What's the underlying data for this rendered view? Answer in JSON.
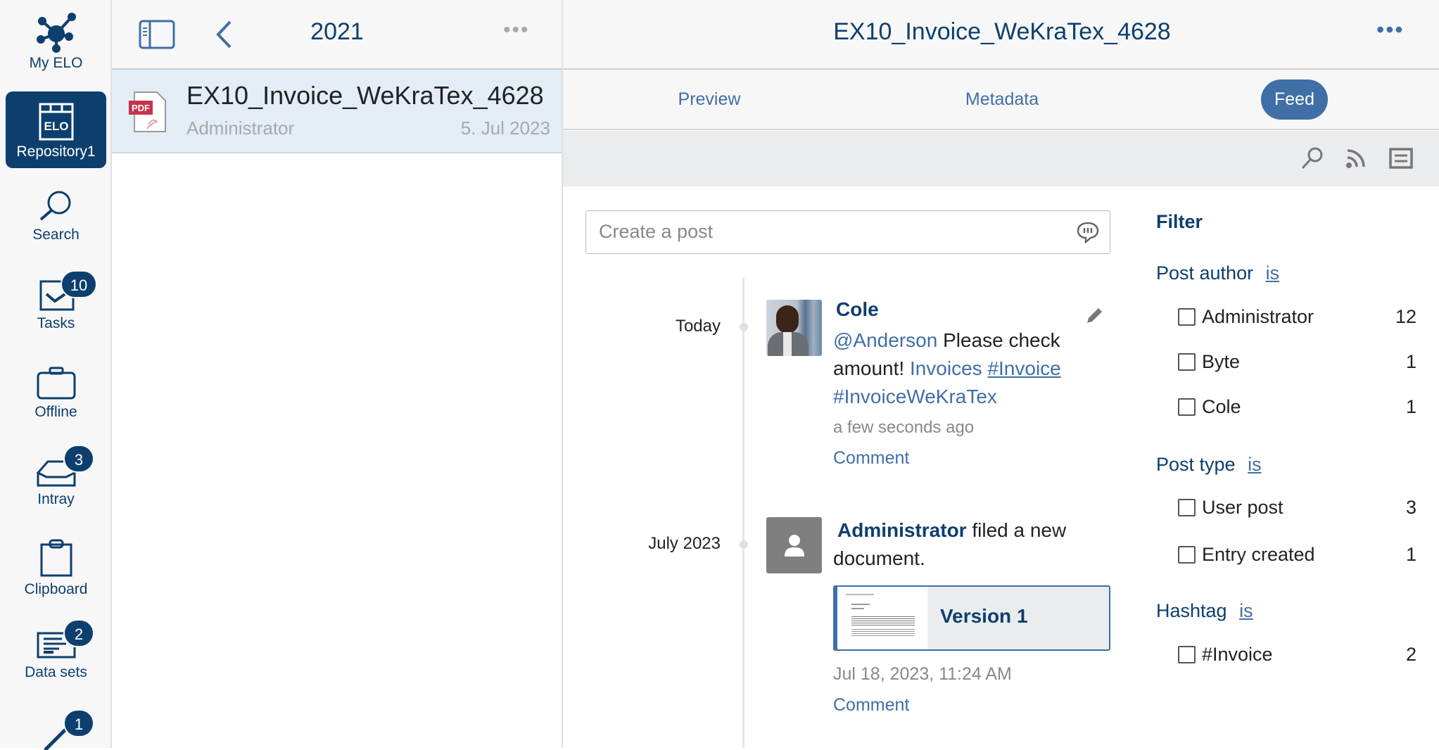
{
  "sidebar": {
    "items": [
      {
        "label": "My ELO",
        "icon": "network-icon"
      },
      {
        "label": "Repository1",
        "icon": "repository-icon",
        "active": true
      },
      {
        "label": "Search",
        "icon": "search-icon"
      },
      {
        "label": "Tasks",
        "icon": "tasks-icon",
        "badge": "10"
      },
      {
        "label": "Offline",
        "icon": "briefcase-icon"
      },
      {
        "label": "Intray",
        "icon": "intray-icon",
        "badge": "3"
      },
      {
        "label": "Clipboard",
        "icon": "clipboard-icon"
      },
      {
        "label": "Data sets",
        "icon": "data-sets-icon",
        "badge": "2"
      },
      {
        "label": "",
        "icon": "pen-icon",
        "badge": "1"
      }
    ]
  },
  "list": {
    "title": "2021",
    "items": [
      {
        "name": "EX10_Invoice_WeKraTex_4628",
        "author": "Administrator",
        "date": "5. Jul 2023",
        "type": "PDF"
      }
    ]
  },
  "viewer": {
    "title": "EX10_Invoice_WeKraTex_4628",
    "tabs": [
      {
        "label": "Preview"
      },
      {
        "label": "Metadata"
      },
      {
        "label": "Feed",
        "active": true
      }
    ]
  },
  "feed": {
    "placeholder": "Create a post",
    "groups": [
      {
        "label": "Today",
        "post": {
          "author": "Cole",
          "mention": "@Anderson",
          "text": " Please check amount! ",
          "link": "Invoices",
          "hashtag1": "#Invoice",
          "hashtag2": "#InvoiceWeKraTex",
          "time": "a few seconds ago",
          "comment": "Comment"
        }
      },
      {
        "label": "July 2023",
        "post": {
          "author": "Administrator",
          "text": " filed a new document.",
          "version": "Version 1",
          "time": "Jul 18, 2023, 11:24 AM",
          "comment": "Comment"
        }
      }
    ]
  },
  "filter": {
    "title": "Filter",
    "sections": [
      {
        "label": "Post author",
        "op": "is",
        "items": [
          {
            "label": "Administrator",
            "count": "12"
          },
          {
            "label": "Byte",
            "count": "1"
          },
          {
            "label": "Cole",
            "count": "1"
          }
        ]
      },
      {
        "label": "Post type",
        "op": "is",
        "items": [
          {
            "label": "User post",
            "count": "3"
          },
          {
            "label": "Entry created",
            "count": "1"
          }
        ]
      },
      {
        "label": "Hashtag",
        "op": "is",
        "items": [
          {
            "label": "#Invoice",
            "count": "2"
          }
        ]
      }
    ]
  },
  "colors": {
    "navy": "#0d3f6e",
    "link": "#3f6fa6",
    "selected": "#e3edf6"
  }
}
